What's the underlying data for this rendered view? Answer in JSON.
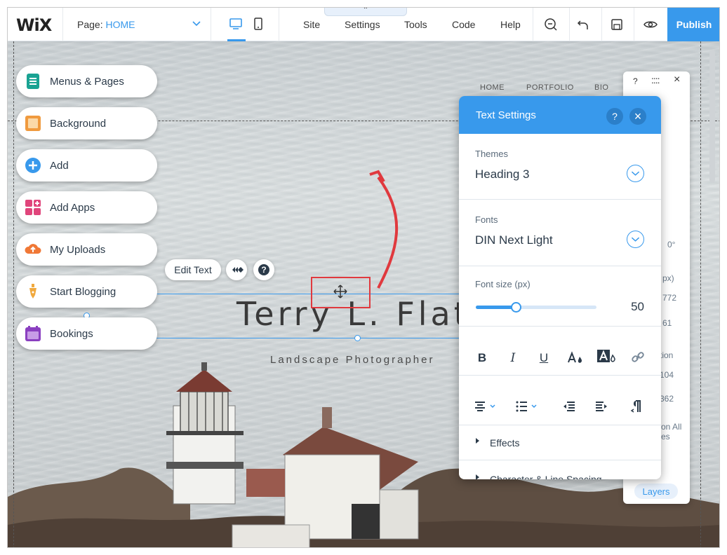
{
  "topbar": {
    "logo": "WiX",
    "page_label": "Page:",
    "page_value": "HOME",
    "menu": [
      "Site",
      "Settings",
      "Tools",
      "Code",
      "Help"
    ],
    "publish_label": "Publish",
    "collapse_glyph": "⌃"
  },
  "site": {
    "nav": [
      "HOME",
      "PORTFOLIO",
      "BIO"
    ],
    "title": "Terry L. Flat",
    "subtitle": "Landscape Photographer"
  },
  "left_panel": {
    "items": [
      {
        "label": "Menus & Pages",
        "icon": "menus-pages-icon",
        "color": "#1aa393"
      },
      {
        "label": "Background",
        "icon": "background-icon",
        "color": "#f09a3e"
      },
      {
        "label": "Add",
        "icon": "add-icon",
        "color": "#3899ec"
      },
      {
        "label": "Add Apps",
        "icon": "add-apps-icon",
        "color": "#e0457b"
      },
      {
        "label": "My Uploads",
        "icon": "uploads-icon",
        "color": "#f07836"
      },
      {
        "label": "Start Blogging",
        "icon": "blog-icon",
        "color": "#f0a93e"
      },
      {
        "label": "Bookings",
        "icon": "bookings-icon",
        "color": "#8a3fc0"
      }
    ]
  },
  "text_toolbar": {
    "edit_label": "Edit Text",
    "help_glyph": "?"
  },
  "text_settings": {
    "title": "Text Settings",
    "help_glyph": "?",
    "close_glyph": "×",
    "themes_label": "Themes",
    "themes_value": "Heading 3",
    "fonts_label": "Fonts",
    "fonts_value": "DIN Next Light",
    "font_size_label": "Font size (px)",
    "font_size_value": "50",
    "slider_fraction": 0.33,
    "format_buttons": [
      "B",
      "I",
      "U"
    ],
    "effects_label": "Effects",
    "char_spacing_label": "Character & Line Spacing"
  },
  "right_panel": {
    "help_glyph": "?",
    "close_glyph": "×",
    "partial_texts": [
      "0°",
      "px)",
      "772",
      "61",
      "tion",
      "104",
      "362",
      "on All",
      "es"
    ],
    "layers_label": "Layers"
  },
  "colors": {
    "accent": "#3899ec",
    "highlight": "#e0393e"
  }
}
